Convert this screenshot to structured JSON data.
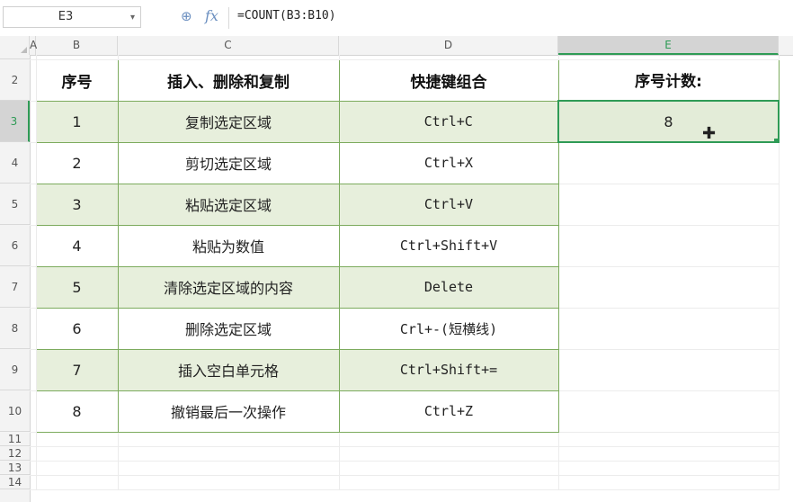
{
  "formula_bar": {
    "cell_ref": "E3",
    "zoom_icon": "zoom-icon",
    "fx_label": "fx",
    "formula": "=COUNT(B3:B10)"
  },
  "columns": [
    "A",
    "B",
    "C",
    "D",
    "E"
  ],
  "rows": [
    "2",
    "3",
    "4",
    "5",
    "6",
    "7",
    "8",
    "9",
    "10",
    "11",
    "12",
    "13",
    "14"
  ],
  "table": {
    "headers": [
      "序号",
      "插入、删除和复制",
      "快捷键组合"
    ],
    "rows": [
      [
        "1",
        "复制选定区域",
        "Ctrl+C"
      ],
      [
        "2",
        "剪切选定区域",
        "Ctrl+X"
      ],
      [
        "3",
        "粘贴选定区域",
        "Ctrl+V"
      ],
      [
        "4",
        "粘贴为数值",
        "Ctrl+Shift+V"
      ],
      [
        "5",
        "清除选定区域的内容",
        "Delete"
      ],
      [
        "6",
        "删除选定区域",
        "Crl+-(短横线)"
      ],
      [
        "7",
        "插入空白单元格",
        "Ctrl+Shift+="
      ],
      [
        "8",
        "撤销最后一次操作",
        "Ctrl+Z"
      ]
    ]
  },
  "count_block": {
    "header": "序号计数:",
    "value": "8"
  },
  "colors": {
    "band": "#e7efdc",
    "border": "#7cab5d",
    "selection": "#2f9b56"
  }
}
